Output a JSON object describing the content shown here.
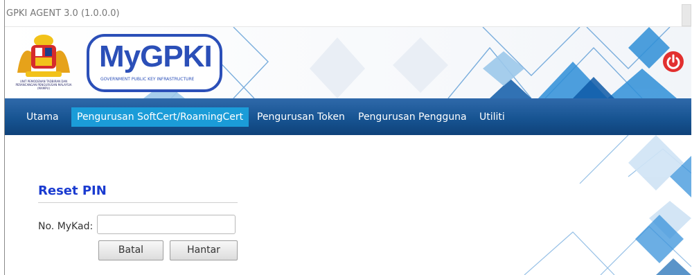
{
  "window": {
    "title": "GPKI AGENT 3.0 (1.0.0.0)"
  },
  "banner": {
    "logo_text": "MyGPKI",
    "logo_subtitle": "GOVERNMENT PUBLIC KEY INFRASTRUCTURE",
    "crest_caption": "UNIT PEMODENAN TADBIRAN DAN PERANCANGAN PENGURUSAN MALAYSIA (MAMPU)"
  },
  "nav": {
    "items": [
      {
        "label": "Utama",
        "active": false
      },
      {
        "label": "Pengurusan SoftCert/RoamingCert",
        "active": true
      },
      {
        "label": "Pengurusan Token",
        "active": false
      },
      {
        "label": "Pengurusan Pengguna",
        "active": false
      },
      {
        "label": "Utiliti",
        "active": false
      }
    ]
  },
  "form": {
    "title": "Reset PIN",
    "mykad_label": "No. MyKad:",
    "mykad_value": "",
    "cancel_label": "Batal",
    "submit_label": "Hantar"
  },
  "colors": {
    "nav_bg": "#175492",
    "nav_active": "#1b9cd8",
    "title_blue": "#1a3bd0",
    "power_red": "#e2302f"
  },
  "icons": {
    "power": "power-icon",
    "crest": "crest-icon",
    "logo": "mygpki-logo"
  }
}
